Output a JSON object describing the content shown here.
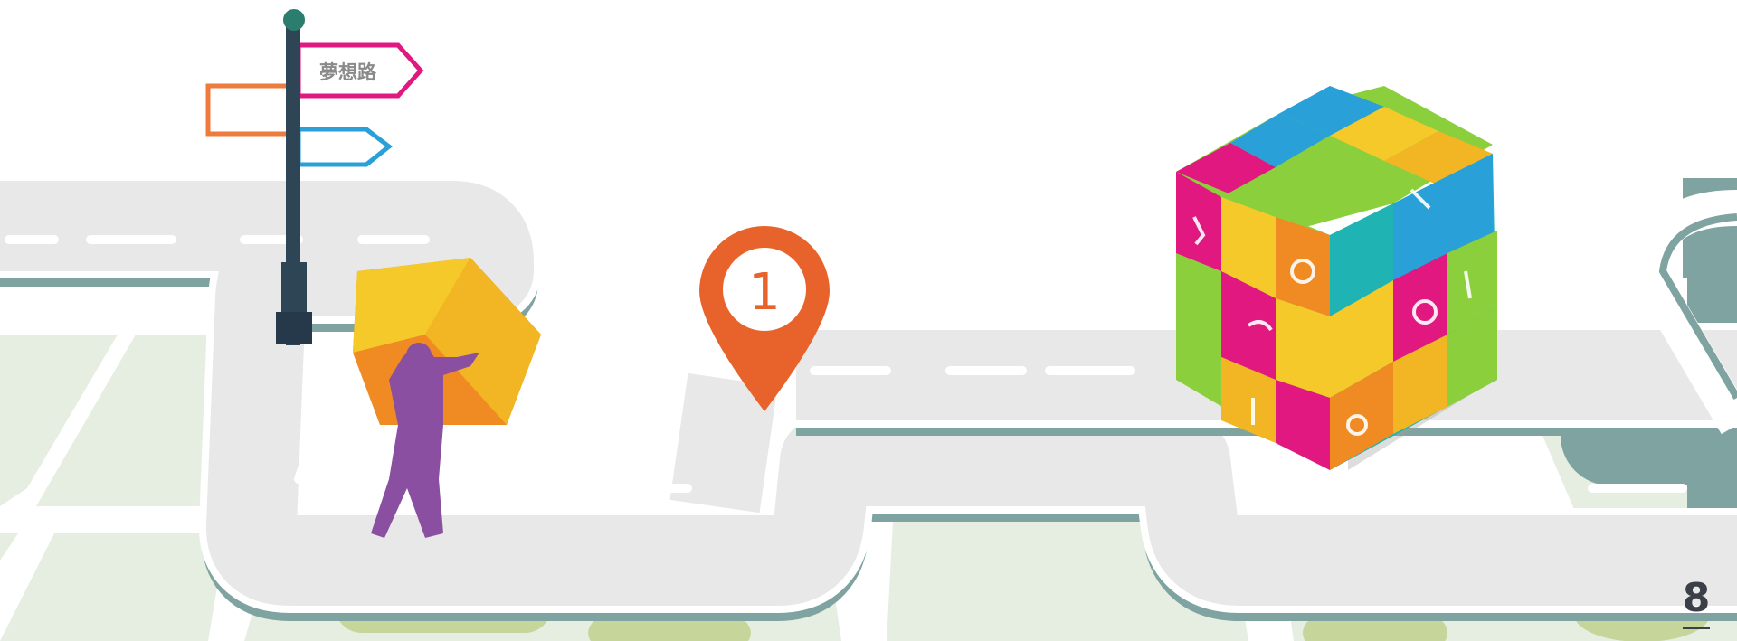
{
  "signpost": {
    "top_sign_label": "夢想路"
  },
  "pin": {
    "number": "1"
  },
  "page": {
    "number": "8"
  },
  "colors": {
    "road": "#e8e8e8",
    "road_edge": "#ffffff",
    "road_shadow": "#7fa3a0",
    "map_block": "#e6eee2",
    "map_block_olive": "#c6d69a",
    "pin": "#e8632b",
    "person": "#8a4fa0",
    "box_yellow": "#f5c92a",
    "box_orange": "#f08a22",
    "sign_pink": "#e0187f",
    "sign_orange": "#ee7a3c",
    "sign_blue": "#2aa0d8",
    "pole": "#2e4556"
  },
  "icons": [
    "signpost-icon",
    "location-pin-icon",
    "person-carrying-box-icon",
    "skills-cube-icon"
  ]
}
